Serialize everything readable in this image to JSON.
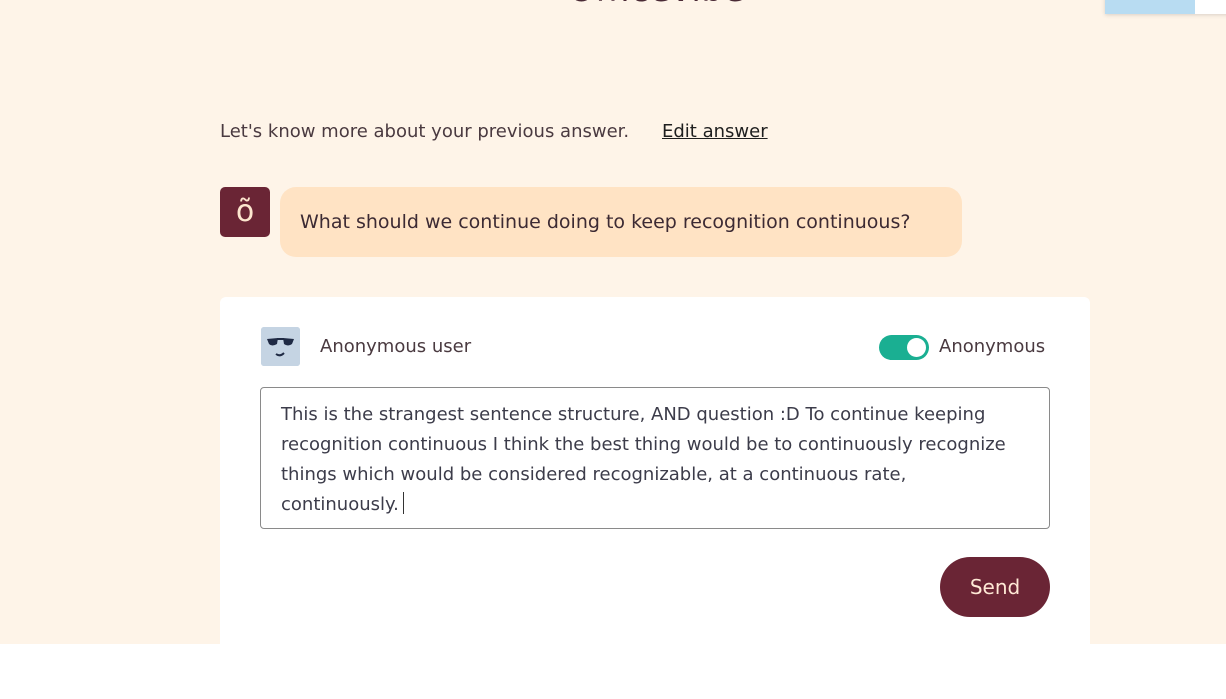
{
  "header": {
    "brand_name": "Officevibe"
  },
  "prompt": {
    "text": "Let's know more about your previous answer.",
    "edit_link_label": "Edit answer"
  },
  "question": {
    "bot_avatar_letter": "õ",
    "text": "What should we continue doing to keep recognition continuous?"
  },
  "answer_card": {
    "user_name": "Anonymous user",
    "toggle_label": "Anonymous",
    "anonymous_enabled": true,
    "answer_text": "This is the strangest sentence structure, AND question :D To continue keeping recognition continuous I think the best thing would be to continuously recognize things which would be considered recognizable, at a continuous rate, continuously.",
    "send_label": "Send"
  },
  "colors": {
    "background": "#fef4e8",
    "accent_maroon": "#6a2535",
    "bubble": "#ffe3c4",
    "toggle_on": "#1aaf92"
  }
}
